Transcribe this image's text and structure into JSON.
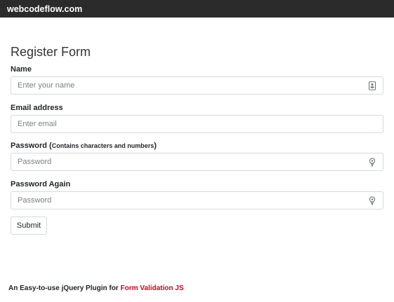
{
  "site": {
    "name": "webcodeflow.com"
  },
  "form": {
    "title": "Register Form",
    "fields": [
      {
        "label": "Name",
        "note": "",
        "placeholder": "Enter your name",
        "icon": "contact-card-icon"
      },
      {
        "label": "Email address",
        "note": "",
        "placeholder": "Enter email",
        "icon": ""
      },
      {
        "label": "Password",
        "note": "Contains characters and numbers",
        "placeholder": "Password",
        "icon": "key-icon"
      },
      {
        "label": "Password Again",
        "note": "",
        "placeholder": "Password",
        "icon": "key-icon"
      }
    ],
    "submit_label": "Submit"
  },
  "footer": {
    "text": "An Easy-to-use jQuery Plugin for",
    "highlight": "Form Validation JS"
  },
  "colors": {
    "topbar": "#2b2b2b",
    "accent": "#d0021b",
    "border": "#d6d9dc"
  }
}
